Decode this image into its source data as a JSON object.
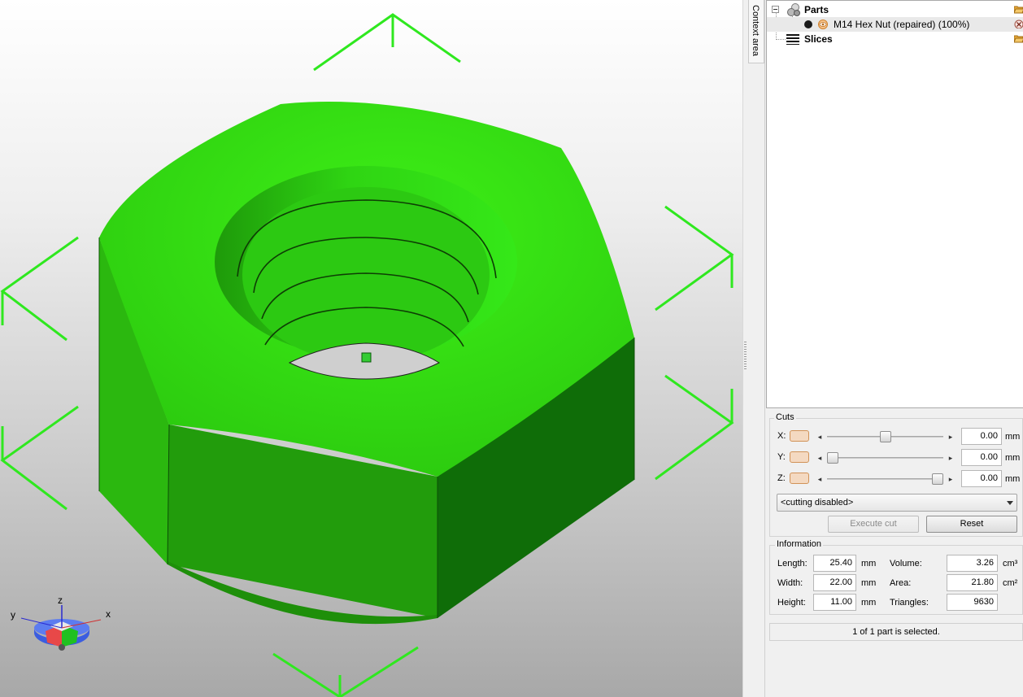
{
  "colors": {
    "model_top": "#2fdc12",
    "model_side": "#229c0c",
    "model_dark": "#0f6d08",
    "bbox": "#2fe81f",
    "selection": "#e9e9e9",
    "swatch": "#d19257"
  },
  "viewport": {
    "axes": {
      "x_label": "x",
      "y_label": "y",
      "z_label": "z"
    }
  },
  "context_area": {
    "label": "Context area"
  },
  "tree": {
    "parts": {
      "label": "Parts",
      "icon": "parts-icon",
      "action_icon": "folder-open-icon"
    },
    "part_item": {
      "label": "M14 Hex Nut (repaired) (100%)",
      "visibility_icon": "eye-icon",
      "remove_icon": "remove-circle-icon"
    },
    "slices": {
      "label": "Slices",
      "icon": "slices-stack-icon",
      "action_icon": "folder-open-icon"
    }
  },
  "cuts": {
    "title": "Cuts",
    "rows": [
      {
        "axis": "X:",
        "value": "0.00",
        "unit": "mm",
        "thumb_fraction": 0.5
      },
      {
        "axis": "Y:",
        "value": "0.00",
        "unit": "mm",
        "thumb_fraction": 0.0
      },
      {
        "axis": "Z:",
        "value": "0.00",
        "unit": "mm",
        "thumb_fraction": 1.0
      }
    ],
    "mode": "<cutting disabled>",
    "execute_label": "Execute cut",
    "reset_label": "Reset"
  },
  "information": {
    "title": "Information",
    "length": {
      "label": "Length:",
      "value": "25.40",
      "unit": "mm"
    },
    "width": {
      "label": "Width:",
      "value": "22.00",
      "unit": "mm"
    },
    "height": {
      "label": "Height:",
      "value": "11.00",
      "unit": "mm"
    },
    "volume": {
      "label": "Volume:",
      "value": "3.26",
      "unit": "cm³"
    },
    "area": {
      "label": "Area:",
      "value": "21.80",
      "unit": "cm²"
    },
    "triangles": {
      "label": "Triangles:",
      "value": "9630"
    }
  },
  "status": {
    "text": "1 of 1 part is selected."
  }
}
